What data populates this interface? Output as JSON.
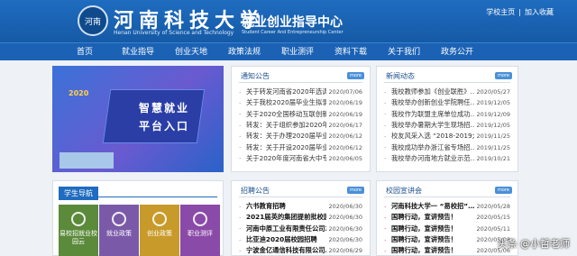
{
  "header": {
    "logo_text": "河南",
    "cn_name": "河南科技大学",
    "en_name": "Henan University of Science and Technology",
    "center_name": "就业创业指导中心",
    "center_en": "Student Career And Entrepreneurship Center",
    "links": [
      "学校主页",
      "加入收藏"
    ],
    "link_sep": "|"
  },
  "nav": [
    "首页",
    "就业指导",
    "创业天地",
    "政策法规",
    "职业测评",
    "资料下载",
    "关于我们",
    "政务公开"
  ],
  "banner": {
    "year": "2020",
    "line1": "智慧就业",
    "line2": "平台入口"
  },
  "more_label": "more",
  "notices": {
    "title": "通知公告",
    "items": [
      {
        "t": "关于转发河南省2020年选调…",
        "d": "2020/07/06"
      },
      {
        "t": "关于我校2020届毕业生拟录…",
        "d": "2020/06/19"
      },
      {
        "t": "关于2020全国移动互联创新…",
        "d": "2020/06/19"
      },
      {
        "t": "转发：关于组织参加2020年…",
        "d": "2020/06/17"
      },
      {
        "t": "转发：关于办理2020届毕业…",
        "d": "2020/06/12"
      },
      {
        "t": "转发：关于开设2020届毕业…",
        "d": "2020/06/12"
      },
      {
        "t": "关于2020年度河南省大中专…",
        "d": "2020/06/05"
      }
    ]
  },
  "news": {
    "title": "新闻动态",
    "items": [
      {
        "t": "我校教师参加《创业联胜》…",
        "d": "2020/05/27"
      },
      {
        "t": "我校举办创新创业学院聘任…",
        "d": "2019/12/05"
      },
      {
        "t": "我校作为联盟主席单位成功…",
        "d": "2019/12/09"
      },
      {
        "t": "我校举办暑期大学生现场招…",
        "d": "2019/12/05"
      },
      {
        "t": "校友风采入选 “2018-2019大…",
        "d": "2019/11/25"
      },
      {
        "t": "我校成功举办浙江省专场招…",
        "d": "2019/11/25"
      },
      {
        "t": "我校举办河南地方就业示范…",
        "d": "2019/10/21"
      }
    ]
  },
  "recruit": {
    "title": "招聘公告",
    "items": [
      {
        "t": "六书教育招聘",
        "d": "2020/06/30"
      },
      {
        "t": "2021届英的集团提前批校园…",
        "d": "2020/06/30"
      },
      {
        "t": "河南中原工业有限责任公司2…",
        "d": "2020/06/30"
      },
      {
        "t": "比亚迪2020届校园招聘",
        "d": "2020/06/30"
      },
      {
        "t": "宁波金亿通信科技有限公司…",
        "d": "2020/06/29"
      }
    ]
  },
  "talks": {
    "title": "校园宣讲会",
    "items": [
      {
        "t": "河南科技大学一 “易校招”…",
        "d": "2020/05/28"
      },
      {
        "t": "国聘行动，宣讲预告！",
        "d": "2020/05/15"
      },
      {
        "t": "国聘行动，宣讲预告！",
        "d": "2020/05/11"
      },
      {
        "t": "国聘行动，宣讲预告！",
        "d": "2020/05/08"
      },
      {
        "t": "国聘行动，宣讲预告！",
        "d": "2020/05/06"
      }
    ]
  },
  "student_nav": {
    "title": "学生导航",
    "tiles": [
      {
        "label": "易校招就业校园云",
        "color": "#5a8a3a"
      },
      {
        "label": "就业政策",
        "color": "#7a5aa8"
      },
      {
        "label": "创业政策",
        "color": "#c89a2a"
      },
      {
        "label": "职业测评",
        "color": "#8a4aa8"
      }
    ]
  },
  "watermark": "头条 @小哲老师"
}
